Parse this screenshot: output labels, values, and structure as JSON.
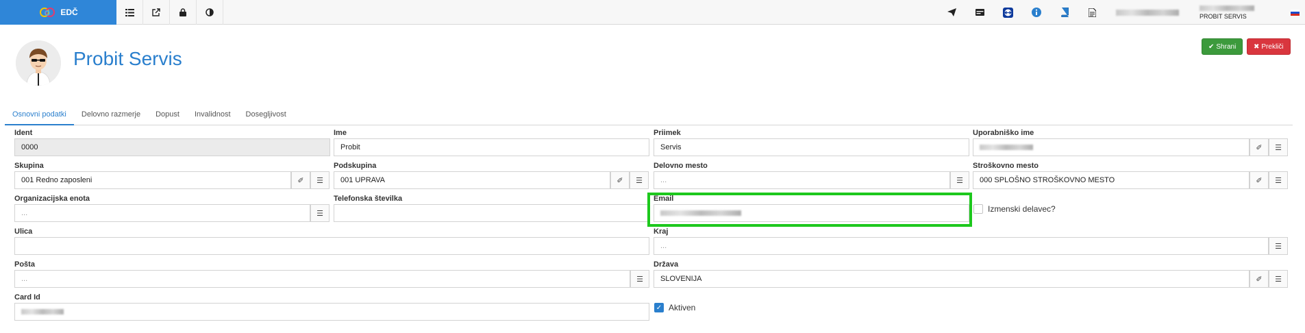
{
  "app": {
    "brand": "EDČ"
  },
  "topbar": {
    "left_icons": [
      "list-icon",
      "external-link-icon",
      "lock-icon",
      "contrast-icon"
    ],
    "right_icons": [
      "send-icon",
      "card-icon",
      "teamviewer-icon",
      "info-icon",
      "book-icon",
      "document-icon"
    ],
    "user_subtitle": "PROBIT SERVIS"
  },
  "page": {
    "title": "Probit Servis"
  },
  "buttons": {
    "save": "Shrani",
    "cancel": "Prekliči"
  },
  "tabs": [
    "Osnovni podatki",
    "Delovno razmerje",
    "Dopust",
    "Invalidnost",
    "Dosegljivost"
  ],
  "form": {
    "ident": {
      "label": "Ident",
      "value": "0000"
    },
    "ime": {
      "label": "Ime",
      "value": "Probit"
    },
    "priimek": {
      "label": "Priimek",
      "value": "Servis"
    },
    "uporabnisko_ime": {
      "label": "Uporabniško ime"
    },
    "skupina": {
      "label": "Skupina",
      "value": "001 Redno zaposleni"
    },
    "podskupina": {
      "label": "Podskupina",
      "value": "001 UPRAVA"
    },
    "delovno_mesto": {
      "label": "Delovno mesto",
      "placeholder": "..."
    },
    "stroskovno_mesto": {
      "label": "Stroškovno mesto",
      "value": "000 SPLOŠNO STROŠKOVNO MESTO"
    },
    "organizacijska_enota": {
      "label": "Organizacijska enota",
      "placeholder": "..."
    },
    "telefonska": {
      "label": "Telefonska številka"
    },
    "email": {
      "label": "Email"
    },
    "izmenski": {
      "label": "Izmenski delavec?"
    },
    "ulica": {
      "label": "Ulica"
    },
    "kraj": {
      "label": "Kraj",
      "placeholder": "..."
    },
    "posta": {
      "label": "Pošta",
      "placeholder": "..."
    },
    "drzava": {
      "label": "Država",
      "value": "SLOVENIJA"
    },
    "card_id": {
      "label": "Card Id"
    },
    "aktiven": {
      "label": "Aktiven"
    }
  },
  "colors": {
    "brand": "#2f86d8",
    "title": "#2a7fcd",
    "save": "#3c9a3c",
    "cancel": "#d9363e",
    "highlight": "#1dc81d"
  }
}
